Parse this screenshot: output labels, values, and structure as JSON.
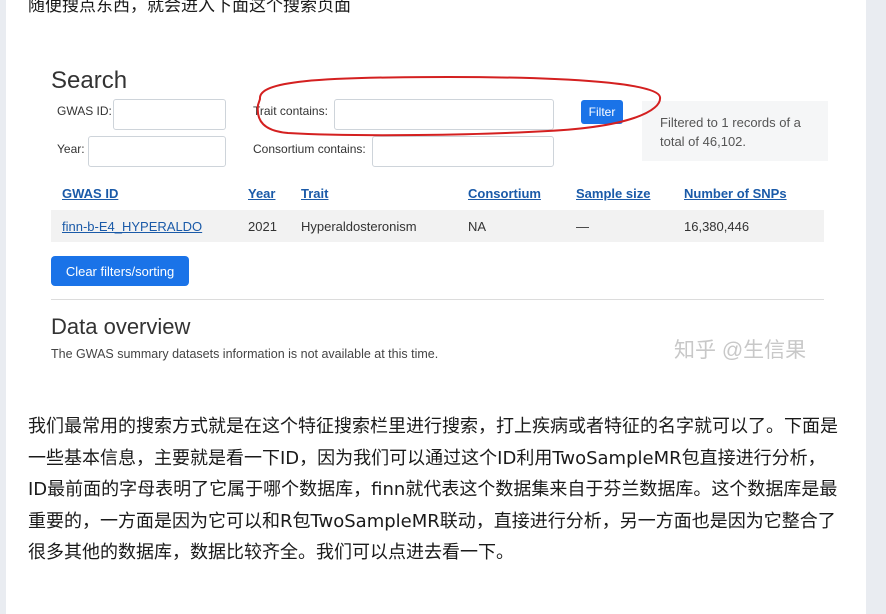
{
  "article": {
    "top_line": "随便搜点东西，就会进入下面这个搜索页面",
    "body_text": "我们最常用的搜索方式就是在这个特征搜索栏里进行搜索，打上疾病或者特征的名字就可以了。下面是一些基本信息，主要就是看一下ID，因为我们可以通过这个ID利用TwoSampleMR包直接进行分析，ID最前面的字母表明了它属于哪个数据库，finn就代表这个数据集来自于芬兰数据库。这个数据库是最重要的，一方面是因为它可以和R包TwoSampleMR联动，直接进行分析，另一方面也是因为它整合了很多其他的数据库，数据比较齐全。我们可以点进去看一下。"
  },
  "search": {
    "title": "Search",
    "gwas_id_label": "GWAS ID:",
    "gwas_id_value": "",
    "year_label": "Year:",
    "year_value": "",
    "trait_label": "Trait contains:",
    "trait_value": "",
    "consortium_label": "Consortium contains:",
    "consortium_value": "",
    "filter_button": "Filter",
    "filter_note": "Filtered to 1 records of a total of 46,102.",
    "annotation_color": "#d42020"
  },
  "table": {
    "headers": [
      "GWAS ID",
      "Year",
      "Trait",
      "Consortium",
      "Sample size",
      "Number of SNPs"
    ],
    "rows": [
      {
        "gwas_id": "finn-b-E4_HYPERALDO",
        "year": "2021",
        "trait": "Hyperaldosteronism",
        "consortium": "NA",
        "sample_size": "—",
        "snps": "16,380,446"
      }
    ]
  },
  "clear_button": "Clear filters/sorting",
  "overview": {
    "title": "Data overview",
    "text": "The GWAS summary datasets information is not available at this time."
  },
  "watermark": "知乎 @生信果",
  "colors": {
    "link": "#1a5aa8",
    "button": "#1a73e8",
    "page_bg": "#e9ecf1"
  }
}
